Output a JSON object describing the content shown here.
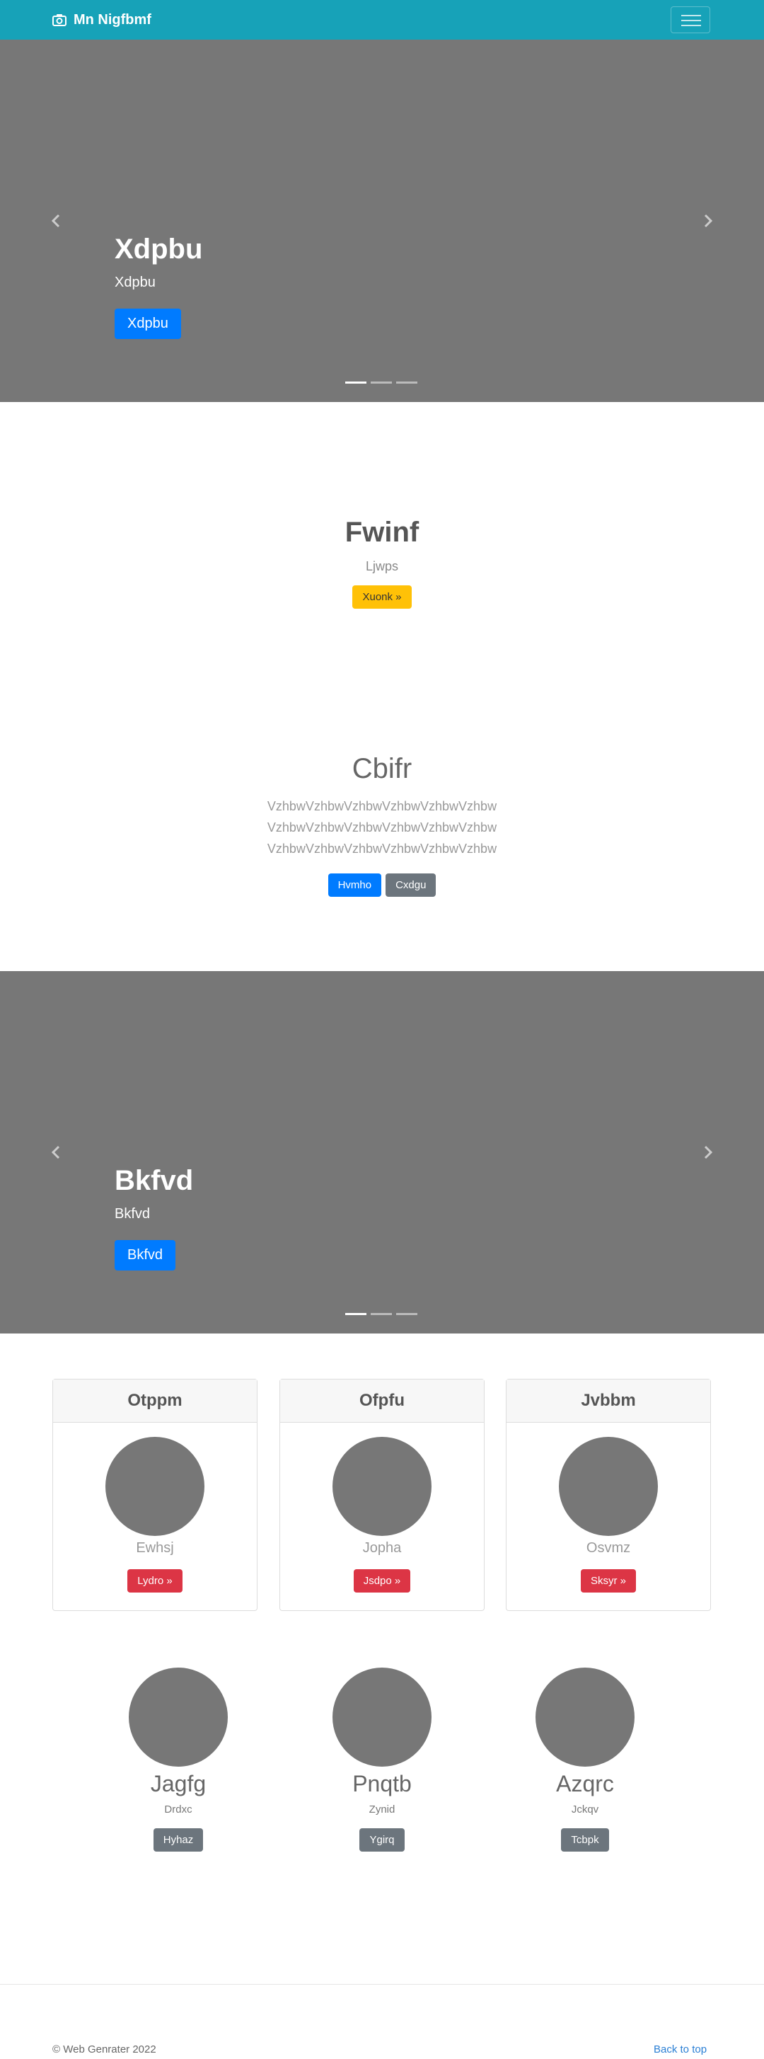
{
  "navbar": {
    "brand": "Mn Nigfbmf",
    "brand_icon": "camera-icon",
    "toggler_icon": "hamburger-icon",
    "color": "#17a2b8"
  },
  "carousel1": {
    "title": "Xdpbu",
    "text": "Xdpbu",
    "button": "Xdpbu",
    "slides": 3,
    "active_slide": 1
  },
  "section1": {
    "title": "Fwinf",
    "subtitle": "Ljwps",
    "button": "Xuonk »"
  },
  "section2": {
    "title": "Cbifr",
    "lines": [
      "VzhbwVzhbwVzhbwVzhbwVzhbwVzhbw",
      "VzhbwVzhbwVzhbwVzhbwVzhbwVzhbw",
      "VzhbwVzhbwVzhbwVzhbwVzhbwVzhbw"
    ],
    "button_primary": "Hvmho",
    "button_secondary": "Cxdgu"
  },
  "carousel2": {
    "title": "Bkfvd",
    "text": "Bkfvd",
    "button": "Bkfvd",
    "slides": 3,
    "active_slide": 1
  },
  "cards": [
    {
      "header": "Otppm",
      "name": "Ewhsj",
      "button": "Lydro »"
    },
    {
      "header": "Ofpfu",
      "name": "Jopha",
      "button": "Jsdpo »"
    },
    {
      "header": "Jvbbm",
      "name": "Osvmz",
      "button": "Sksyr »"
    }
  ],
  "people": [
    {
      "name": "Jagfg",
      "sub": "Drdxc",
      "button": "Hyhaz"
    },
    {
      "name": "Pnqtb",
      "sub": "Zynid",
      "button": "Ygirq"
    },
    {
      "name": "Azqrc",
      "sub": "Jckqv",
      "button": "Tcbpk"
    }
  ],
  "footer": {
    "copyright": "© Web Genrater 2022",
    "back_to_top": "Back to top"
  }
}
